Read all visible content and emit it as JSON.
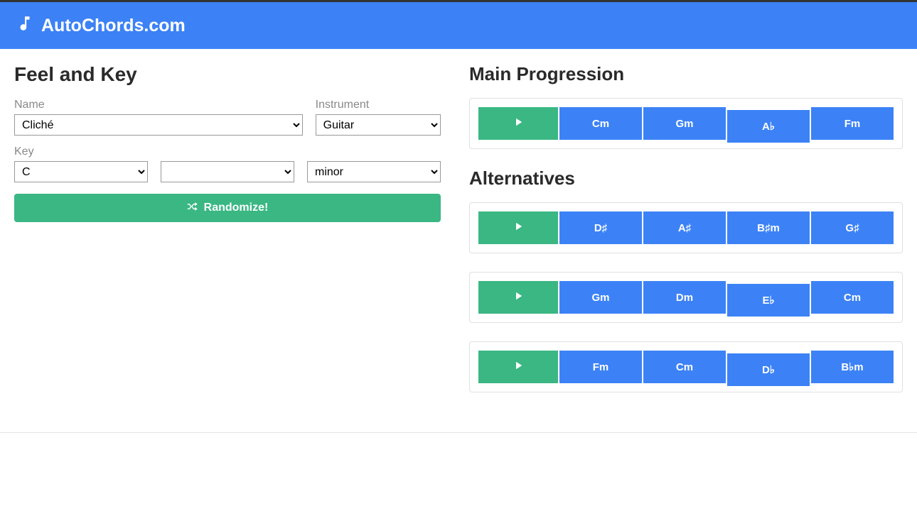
{
  "site": {
    "name": "AutoChords.com"
  },
  "left": {
    "title": "Feel and Key",
    "name_label": "Name",
    "name_value": "Cliché",
    "instrument_label": "Instrument",
    "instrument_value": "Guitar",
    "key_label": "Key",
    "key_value": "C",
    "accidental_value": "",
    "mode_value": "minor",
    "randomize_label": "Randomize!"
  },
  "right": {
    "main_title": "Main Progression",
    "alternatives_title": "Alternatives",
    "main": {
      "chords": [
        "Cm",
        "Gm",
        "A♭",
        "Fm"
      ]
    },
    "alts": [
      {
        "chords": [
          "D♯",
          "A♯",
          "B♯m",
          "G♯"
        ]
      },
      {
        "chords": [
          "Gm",
          "Dm",
          "E♭",
          "Cm"
        ]
      },
      {
        "chords": [
          "Fm",
          "Cm",
          "D♭",
          "B♭m"
        ]
      }
    ]
  }
}
